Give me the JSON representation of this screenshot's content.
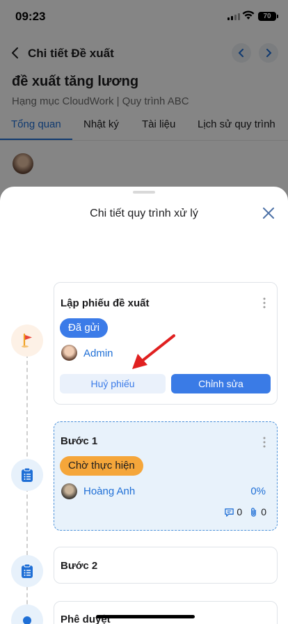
{
  "status_bar": {
    "time": "09:23",
    "battery": "70"
  },
  "nav": {
    "title": "Chi tiết Đề xuất"
  },
  "page": {
    "title": "đề xuất tăng lương",
    "subtitle": "Hạng mục CloudWork | Quy trình ABC"
  },
  "tabs": [
    {
      "label": "Tổng quan",
      "active": true
    },
    {
      "label": "Nhật ký"
    },
    {
      "label": "Tài liệu"
    },
    {
      "label": "Lịch sử quy trình"
    }
  ],
  "sheet": {
    "title": "Chi tiết quy trình xử lý",
    "steps": [
      {
        "title": "Lập phiếu đề xuất",
        "status": "Đã gửi",
        "user": "Admin",
        "cancel_label": "Huỷ phiếu",
        "edit_label": "Chỉnh sửa",
        "icon": "flag-icon"
      },
      {
        "title": "Bước 1",
        "status": "Chờ thực hiện",
        "user": "Hoàng Anh",
        "progress": "0%",
        "comments": "0",
        "attachments": "0",
        "icon": "clipboard-icon"
      },
      {
        "title": "Bước 2",
        "icon": "clipboard-icon"
      },
      {
        "title": "Phê duyệt",
        "icon": "dot-icon"
      }
    ]
  },
  "colors": {
    "accent": "#1f6fd6",
    "sent": "#3b7be8",
    "waiting": "#f5a63a",
    "arrow": "#e02020"
  }
}
